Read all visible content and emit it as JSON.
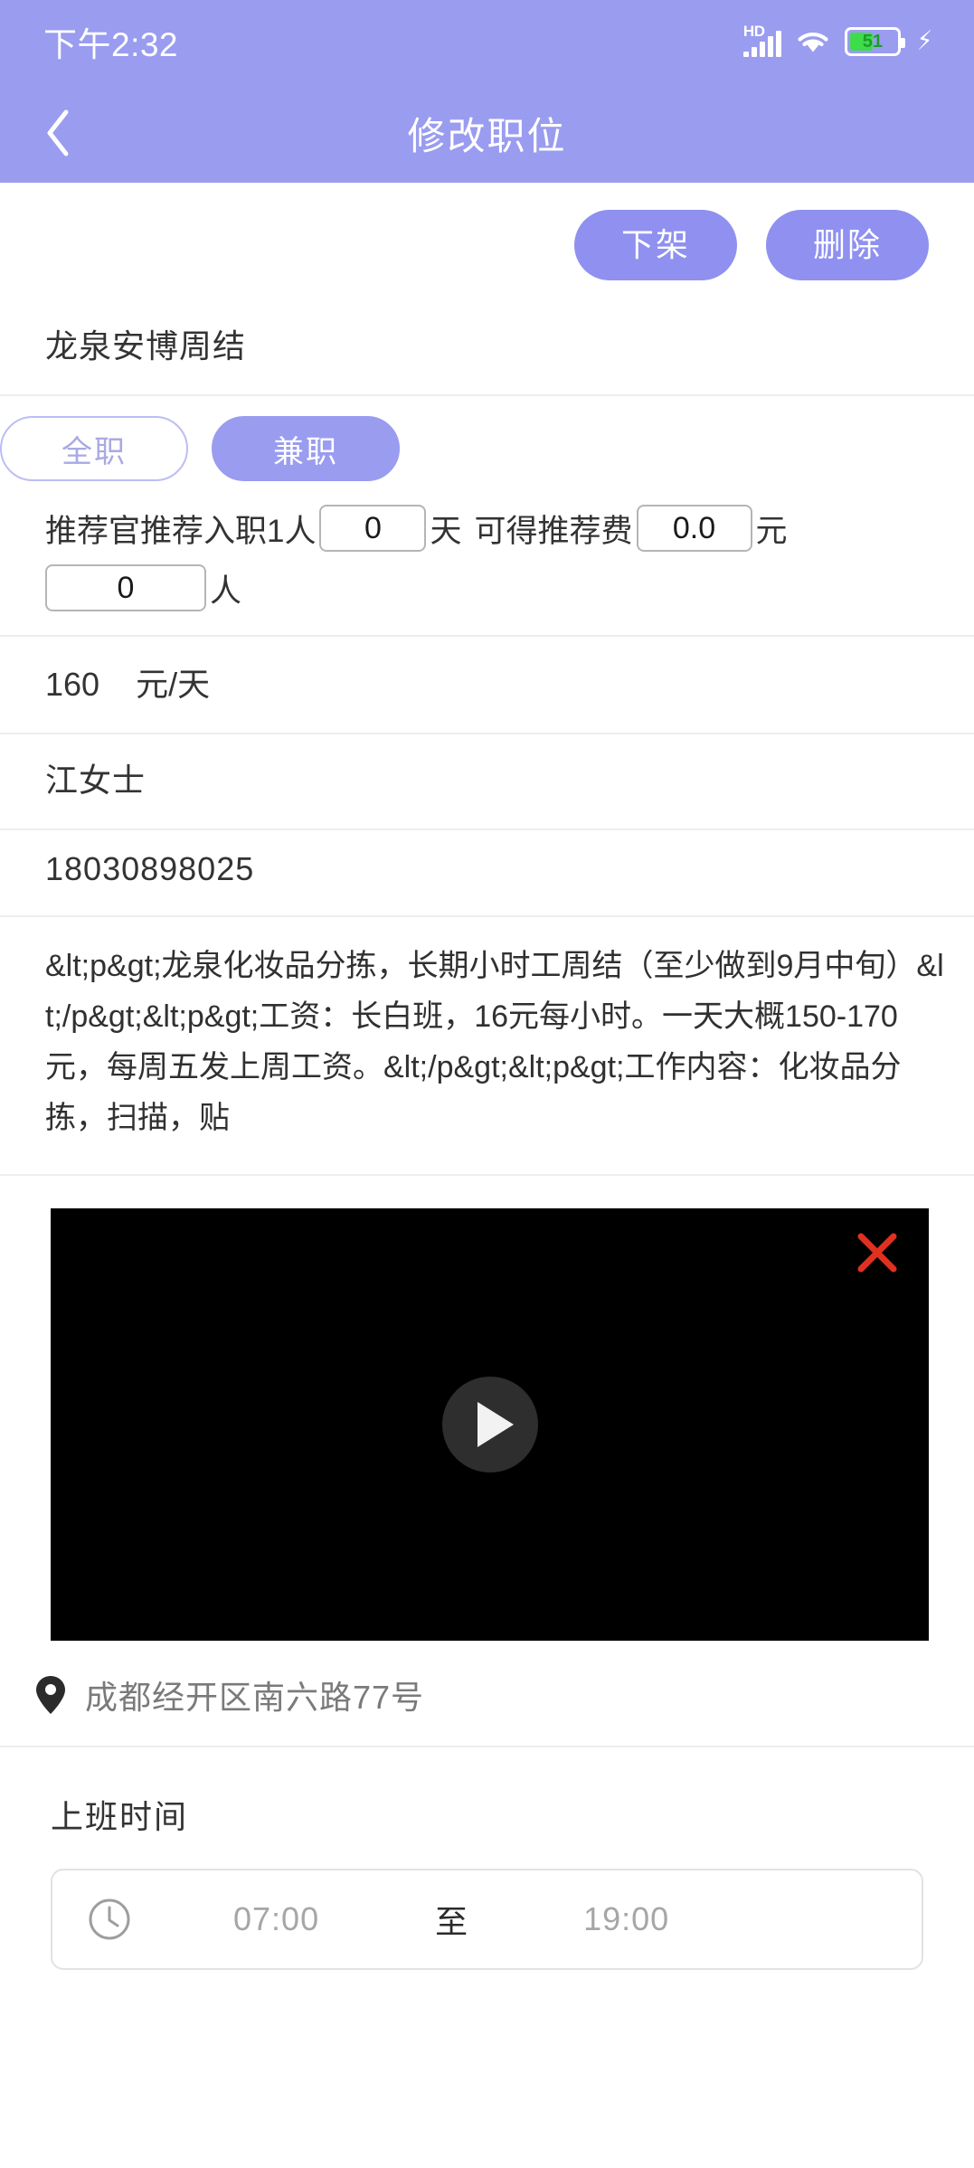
{
  "status_bar": {
    "time": "下午2:32",
    "network_label": "HD",
    "battery_level": "51",
    "signal_icon": "signal-bars-icon",
    "wifi_icon": "wifi-icon",
    "battery_icon": "battery-icon",
    "charging_icon": "charging-bolt-icon"
  },
  "navbar": {
    "back_icon": "chevron-left-icon",
    "title": "修改职位"
  },
  "actions": {
    "takedown_label": "下架",
    "delete_label": "删除"
  },
  "job": {
    "title": "龙泉安博周结",
    "job_type_tabs": [
      {
        "label": "全职",
        "selected": false
      },
      {
        "label": "兼职",
        "selected": true
      }
    ],
    "referral": {
      "prefix": "推荐官推荐入职1人",
      "days_value": "0",
      "days_unit": "天",
      "fee_label": "可得推荐费",
      "fee_value": "0.0",
      "fee_unit": "元",
      "headcount_value": "0",
      "headcount_unit": "人"
    },
    "salary": {
      "amount": "160",
      "unit": "元/天"
    },
    "contact_name": "江女士",
    "contact_phone": "18030898025",
    "description": "&lt;p&gt;龙泉化妆品分拣，长期小时工周结（至少做到9月中旬）&lt;/p&gt;&lt;p&gt;工资：长白班，16元每小时。一天大概150-170元，每周五发上周工资。&lt;/p&gt;&lt;p&gt;工作内容：化妆品分拣，扫描，贴"
  },
  "video": {
    "close_icon": "close-x-icon",
    "play_icon": "play-icon"
  },
  "location": {
    "pin_icon": "location-pin-icon",
    "address": "成都经开区南六路77号"
  },
  "work_time": {
    "section_label": "上班时间",
    "clock_icon": "clock-icon",
    "start": "07:00",
    "separator": "至",
    "end": "19:00"
  },
  "colors": {
    "header_purple": "#9a9cf0",
    "button_purple": "#8f90f0",
    "battery_green": "#3ddc4a",
    "close_red": "#e03020"
  }
}
